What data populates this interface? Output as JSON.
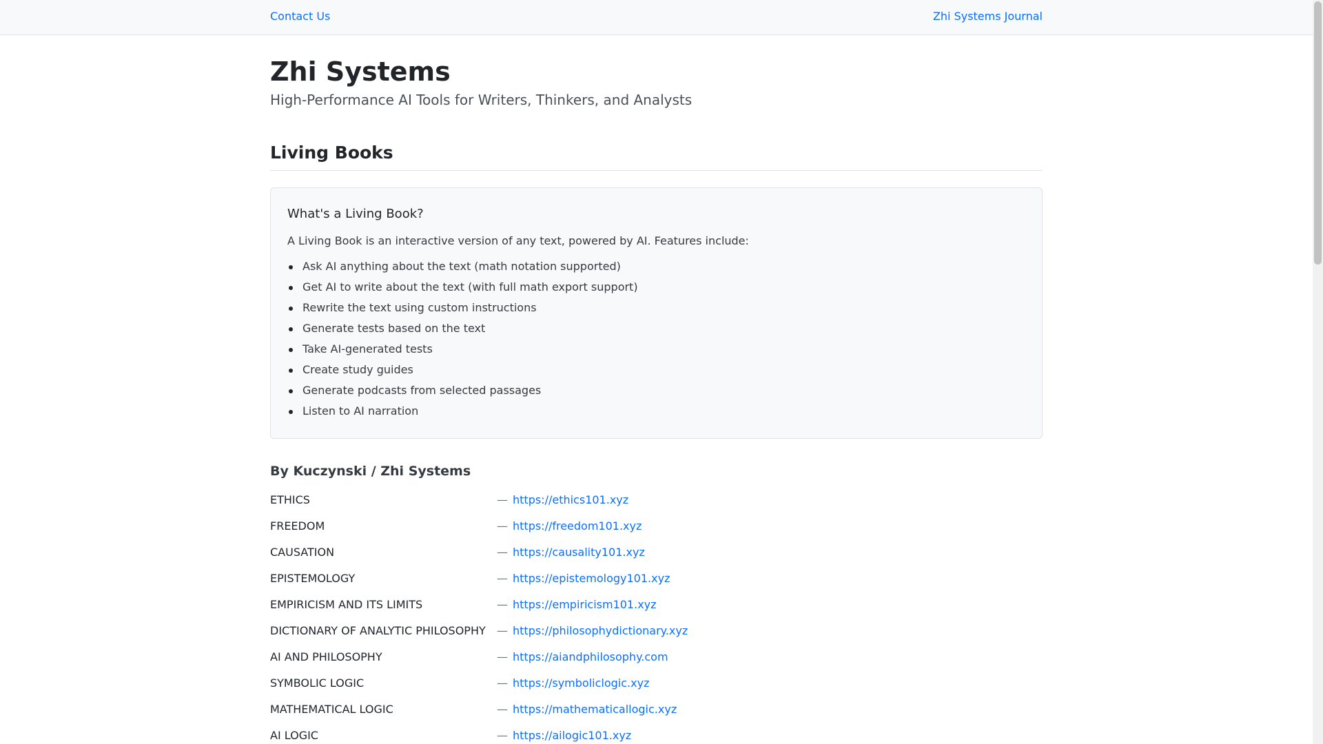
{
  "nav": {
    "contact_label": "Contact Us",
    "journal_label": "Zhi Systems Journal"
  },
  "header": {
    "title": "Zhi Systems",
    "tagline": "High-Performance AI Tools for Writers, Thinkers, and Analysts"
  },
  "section": {
    "title": "Living Books"
  },
  "card": {
    "heading": "What's a Living Book?",
    "intro": "A Living Book is an interactive version of any text, powered by AI. Features include:",
    "features": [
      "Ask AI anything about the text (math notation supported)",
      "Get AI to write about the text (with full math export support)",
      "Rewrite the text using custom instructions",
      "Generate tests based on the text",
      "Take AI-generated tests",
      "Create study guides",
      "Generate podcasts from selected passages",
      "Listen to AI narration"
    ]
  },
  "books": {
    "heading": "By Kuczynski / Zhi Systems",
    "separator": "—",
    "items": [
      {
        "title": "ETHICS",
        "url": "https://ethics101.xyz"
      },
      {
        "title": "FREEDOM",
        "url": "https://freedom101.xyz"
      },
      {
        "title": "CAUSATION",
        "url": "https://causality101.xyz"
      },
      {
        "title": "EPISTEMOLOGY",
        "url": "https://epistemology101.xyz"
      },
      {
        "title": "EMPIRICISM AND ITS LIMITS",
        "url": "https://empiricism101.xyz"
      },
      {
        "title": "DICTIONARY OF ANALYTIC PHILOSOPHY",
        "url": "https://philosophydictionary.xyz"
      },
      {
        "title": "AI AND PHILOSOPHY",
        "url": "https://aiandphilosophy.com"
      },
      {
        "title": "SYMBOLIC LOGIC",
        "url": "https://symboliclogic.xyz"
      },
      {
        "title": "MATHEMATICAL LOGIC",
        "url": "https://mathematicallogic.xyz"
      },
      {
        "title": "AI LOGIC",
        "url": "https://ailogic101.xyz"
      }
    ]
  }
}
